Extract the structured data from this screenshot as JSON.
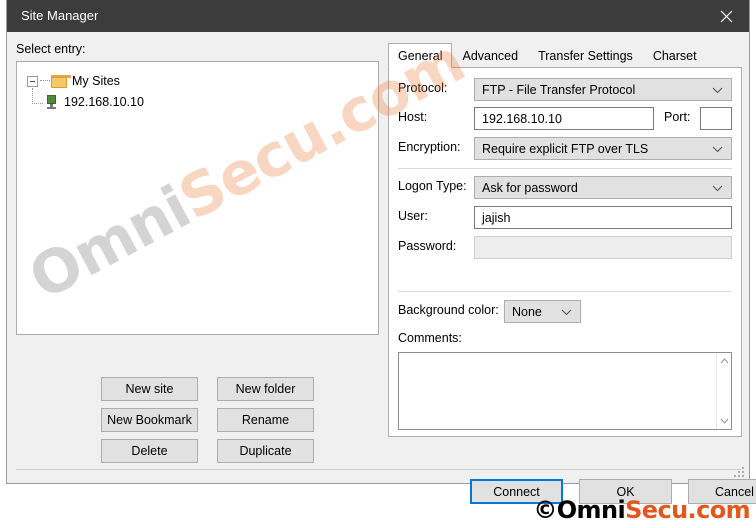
{
  "window": {
    "title": "Site Manager",
    "close_icon": "close-icon"
  },
  "left": {
    "select_entry_label": "Select entry:",
    "tree": [
      {
        "label": "My Sites",
        "icon": "folder-icon",
        "level": 0,
        "expanded": true
      },
      {
        "label": "192.168.10.10",
        "icon": "server-icon",
        "level": 1,
        "selected": true
      }
    ],
    "buttons": [
      "New site",
      "New folder",
      "New Bookmark",
      "Rename",
      "Delete",
      "Duplicate"
    ]
  },
  "right": {
    "tabs": [
      {
        "label": "General",
        "active": true
      },
      {
        "label": "Advanced",
        "active": false
      },
      {
        "label": "Transfer Settings",
        "active": false
      },
      {
        "label": "Charset",
        "active": false
      }
    ],
    "fields": {
      "protocol_label": "Protocol:",
      "protocol_value": "FTP - File Transfer Protocol",
      "host_label": "Host:",
      "host_value": "192.168.10.10",
      "port_label": "Port:",
      "port_value": "",
      "encryption_label": "Encryption:",
      "encryption_value": "Require explicit FTP over TLS",
      "logon_type_label": "Logon Type:",
      "logon_type_value": "Ask for password",
      "user_label": "User:",
      "user_value": "jajish",
      "password_label": "Password:",
      "password_value": "",
      "background_color_label": "Background color:",
      "background_color_value": "None",
      "comments_label": "Comments:",
      "comments_value": ""
    }
  },
  "footer": {
    "buttons": [
      {
        "label": "Connect",
        "focused": true
      },
      {
        "label": "OK",
        "focused": false
      },
      {
        "label": "Cancel",
        "focused": false
      }
    ]
  },
  "watermark": {
    "diagonal_part1": "Omni",
    "diagonal_part2": "Secu.com",
    "footer_part1": "©Omni",
    "footer_part2": "Secu.com"
  },
  "colors": {
    "accent_focus": "#0078D7",
    "titlebar": "#3C3C3C",
    "dialog_face": "#F0F0F0",
    "watermark_orange": "#E2571E"
  }
}
